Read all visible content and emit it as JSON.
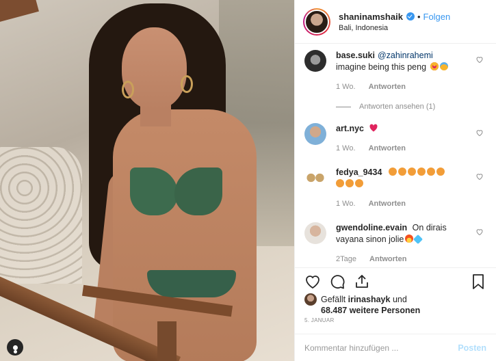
{
  "header": {
    "username": "shaninamshaik",
    "separator": "•",
    "follow_label": "Folgen",
    "location": "Bali, Indonesia"
  },
  "comments": [
    {
      "user": "base.suki",
      "mention": "@zahinrahemi",
      "text": "imagine being this peng",
      "time": "1 Wo.",
      "reply_label": "Antworten"
    },
    {
      "user": "art.nyc",
      "mention": "",
      "text": "",
      "time": "1 Wo.",
      "reply_label": "Antworten"
    },
    {
      "user": "fedya_9434",
      "mention": "",
      "text": "",
      "time": "1 Wo.",
      "reply_label": "Antworten"
    },
    {
      "user": "gwendoline.evain",
      "mention": "",
      "text": "On dirais vayana sinon jolie",
      "time": "2Tage",
      "reply_label": "Antworten"
    }
  ],
  "view_replies_label": "Antworten ansehen (1)",
  "likes": {
    "prefix": "Gefällt",
    "user": "irinashayk",
    "connector": "und",
    "count_text": "68.487 weitere Personen"
  },
  "date": "5. JANUAR",
  "add_comment": {
    "placeholder": "Kommentar hinzufügen ...",
    "post_label": "Posten"
  },
  "colors": {
    "accent": "#3897f0",
    "text": "#262626",
    "muted": "#8e8e8e",
    "post_disabled": "#b2dffc"
  },
  "icons": [
    "heart-icon",
    "comment-icon",
    "share-icon",
    "bookmark-icon",
    "verified-badge-icon",
    "user-tag-icon"
  ]
}
